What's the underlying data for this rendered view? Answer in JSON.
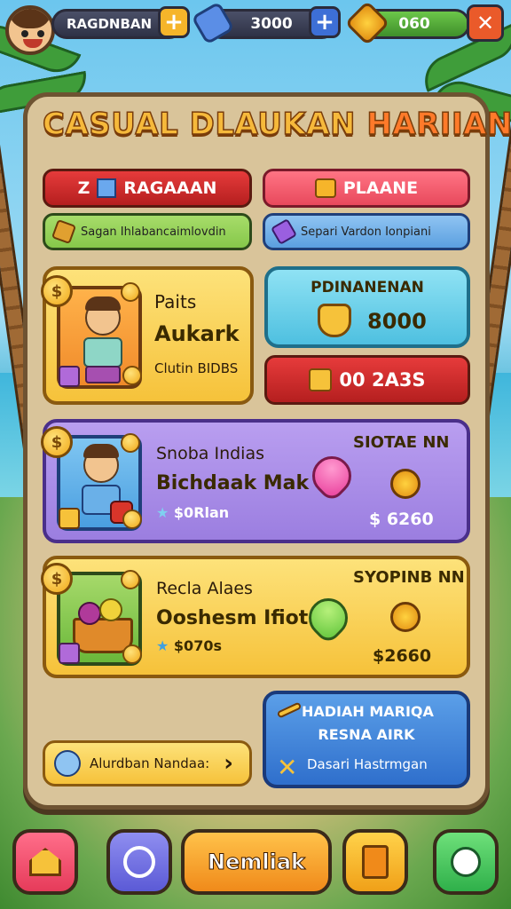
{
  "hud": {
    "player_name": "RAGDNBAN",
    "currency_amount": "3000",
    "gem_amount": "060",
    "plus_symbol": "+",
    "close_symbol": "✕"
  },
  "title": {
    "part1": "CASUAL DLAUKAN",
    "part2": "HARIIAN"
  },
  "tabs": [
    {
      "label": "RAGAAAN",
      "prefix": "Z"
    },
    {
      "label": "PLAANE"
    }
  ],
  "subtabs": [
    {
      "label": "Sagan Ihlabancaimlovdin"
    },
    {
      "label": "Separi Vardon Ionpiani"
    }
  ],
  "featured": {
    "line1": "Paits",
    "line2": "Aukark",
    "line3": "Clutin BIDBS"
  },
  "reward_box": {
    "title": "PDINANENAN",
    "amount": "8000"
  },
  "red_button": {
    "label": "00 2A3S"
  },
  "offer1": {
    "title": "Snoba Indias",
    "subtitle": "Bichdaak Mak",
    "rating": "$0Rlan",
    "badge": "SIOTAE NN",
    "price": "$ 6260"
  },
  "offer2": {
    "title": "Recla Alaes",
    "subtitle": "Ooshesm Ifiot",
    "rating": "$070s",
    "badge": "SYOPINB NN",
    "price": "$2660"
  },
  "blue_card": {
    "line1": "HADIAH MARIQA",
    "line2": "RESNA AIRK",
    "line3": "Dasari Hastrmgan"
  },
  "chat_pill": {
    "label": "Alurdban Nandaa:",
    "arrow": "›"
  },
  "bottom_nav": {
    "main_label": "Nemliak"
  },
  "colors": {
    "panel": "#d9c49a",
    "yellow_card": "#fbd75a",
    "purple_card": "#a98ee6",
    "blue_card": "#3d7fd6",
    "red_tab": "#d42a2a",
    "pink_tab": "#f45b6c"
  }
}
